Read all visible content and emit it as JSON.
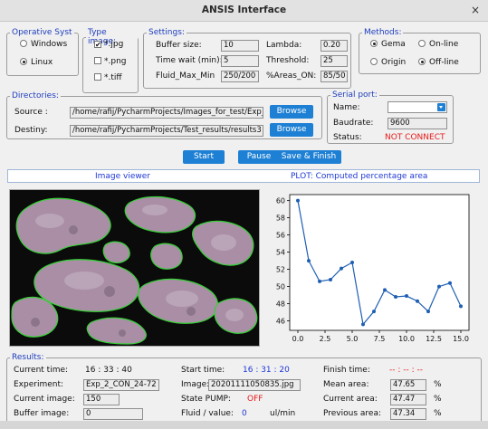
{
  "window": {
    "title": "ANSIS Interface",
    "close": "×"
  },
  "operative": {
    "legend": "Operative Syst",
    "options": [
      {
        "label": "Windows",
        "selected": false
      },
      {
        "label": "Linux",
        "selected": true
      }
    ]
  },
  "type_image": {
    "legend": "Type image:",
    "options": [
      {
        "label": "*.jpg",
        "checked": true
      },
      {
        "label": "*.png",
        "checked": false
      },
      {
        "label": "*.tiff",
        "checked": false
      }
    ]
  },
  "settings": {
    "legend": "Settings:",
    "buffer_size_label": "Buffer size:",
    "buffer_size": "10",
    "lambda_label": "Lambda:",
    "lambda": "0.20",
    "time_wait_label": "Time wait (min):",
    "time_wait": "5",
    "threshold_label": "Threshold:",
    "threshold": "25",
    "fluid_max_min_label": "Fluid_Max_Min",
    "fluid_max_min": "250/200",
    "areas_on_label": "%Areas_ON:",
    "areas_on": "85/50"
  },
  "methods": {
    "legend": "Methods:",
    "options": [
      {
        "label": "Gema",
        "selected": true
      },
      {
        "label": "On-line",
        "selected": false
      },
      {
        "label": "Origin",
        "selected": false
      },
      {
        "label": "Off-line",
        "selected": true
      }
    ]
  },
  "directories": {
    "legend": "Directories:",
    "source_label": "Source :",
    "source": "/home/rafij/PycharmProjects/Images_for_test/Exp_2_CON_24-72",
    "destiny_label": "Destiny:",
    "destiny": "/home/rafij/PycharmProjects/Test_results/results3",
    "browse_label": "Browse"
  },
  "serial": {
    "legend": "Serial port:",
    "name_label": "Name:",
    "name": "",
    "baudrate_label": "Baudrate:",
    "baudrate": "9600",
    "status_label": "Status:",
    "status": "NOT CONNECT"
  },
  "controls": {
    "start": "Start",
    "pause": "Pause",
    "save_finish": "Save & Finish"
  },
  "viewer": {
    "image_label": "Image viewer",
    "plot_label": "PLOT: Computed percentage area"
  },
  "results": {
    "legend": "Results:",
    "current_time_label": "Current time:",
    "current_time": "16 : 33 : 40",
    "start_time_label": "Start time:",
    "start_time": "16 : 31 : 20",
    "finish_time_label": "Finish time:",
    "finish_time": "-- : -- : --",
    "experiment_label": "Experiment:",
    "experiment": "Exp_2_CON_24-72",
    "image_label": "Image:",
    "image": "20201111050835.jpg",
    "mean_area_label": "Mean area:",
    "mean_area": "47.65",
    "current_image_label": "Current image:",
    "current_image": "150",
    "state_pump_label": "State PUMP:",
    "state_pump": "OFF",
    "current_area_label": "Current area:",
    "current_area": "47.47",
    "buffer_image_label": "Buffer image:",
    "buffer_image": "0",
    "fluid_value_label": "Fluid / value:",
    "fluid_value": "0",
    "fluid_unit": "ul/min",
    "previous_area_label": "Previous area:",
    "previous_area": "47.34",
    "percent": "%"
  },
  "colors": {
    "accent": "#1e80d4",
    "legend": "#1d3dbd",
    "alert": "#e81a1a",
    "plot_line": "#1f5fb3",
    "contour": "#35d135"
  },
  "chart_data": {
    "type": "line",
    "x": [
      0,
      1,
      2,
      3,
      4,
      5,
      6,
      7,
      8,
      9,
      10,
      11,
      12,
      13,
      14,
      15
    ],
    "series": [
      {
        "values": [
          60.0,
          53.0,
          50.6,
          50.8,
          52.1,
          52.8,
          45.6,
          47.1,
          49.6,
          48.8,
          48.9,
          48.3,
          47.1,
          50.0,
          50.4,
          47.7
        ]
      }
    ],
    "xticks": [
      "0.0",
      "2.5",
      "5.0",
      "7.5",
      "10.0",
      "12.5",
      "15.0"
    ],
    "yticks": [
      "46",
      "48",
      "50",
      "52",
      "54",
      "56",
      "58",
      "60"
    ],
    "xlim": [
      -0.75,
      15.75
    ],
    "ylim": [
      44.9,
      60.7
    ],
    "grid": false,
    "title": "",
    "xlabel": "",
    "ylabel": ""
  }
}
